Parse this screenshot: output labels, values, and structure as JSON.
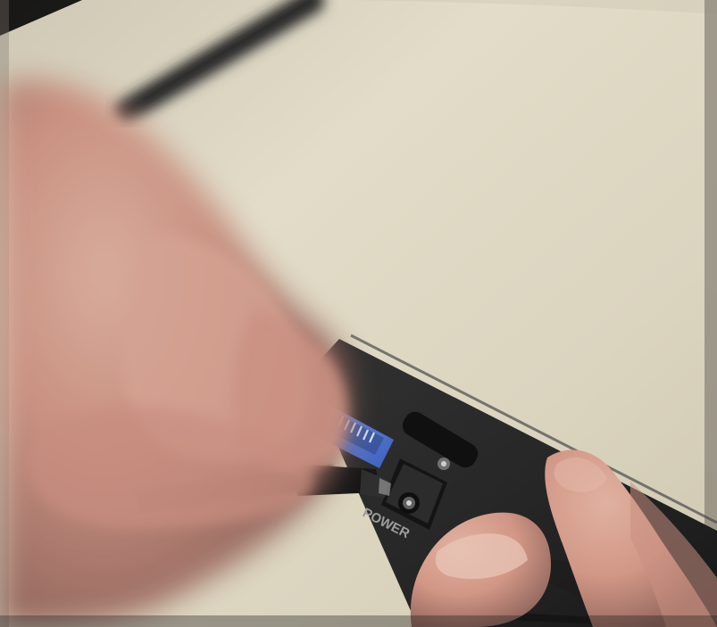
{
  "photo": {
    "device_port_labels": {
      "power": "POWER"
    },
    "colors": {
      "desk": "#ddd8c3",
      "desk_shadow": "#bdb7a2",
      "device": "#252525",
      "ethernet_port": "#4c6fcc",
      "skin": "#d7a191"
    }
  }
}
